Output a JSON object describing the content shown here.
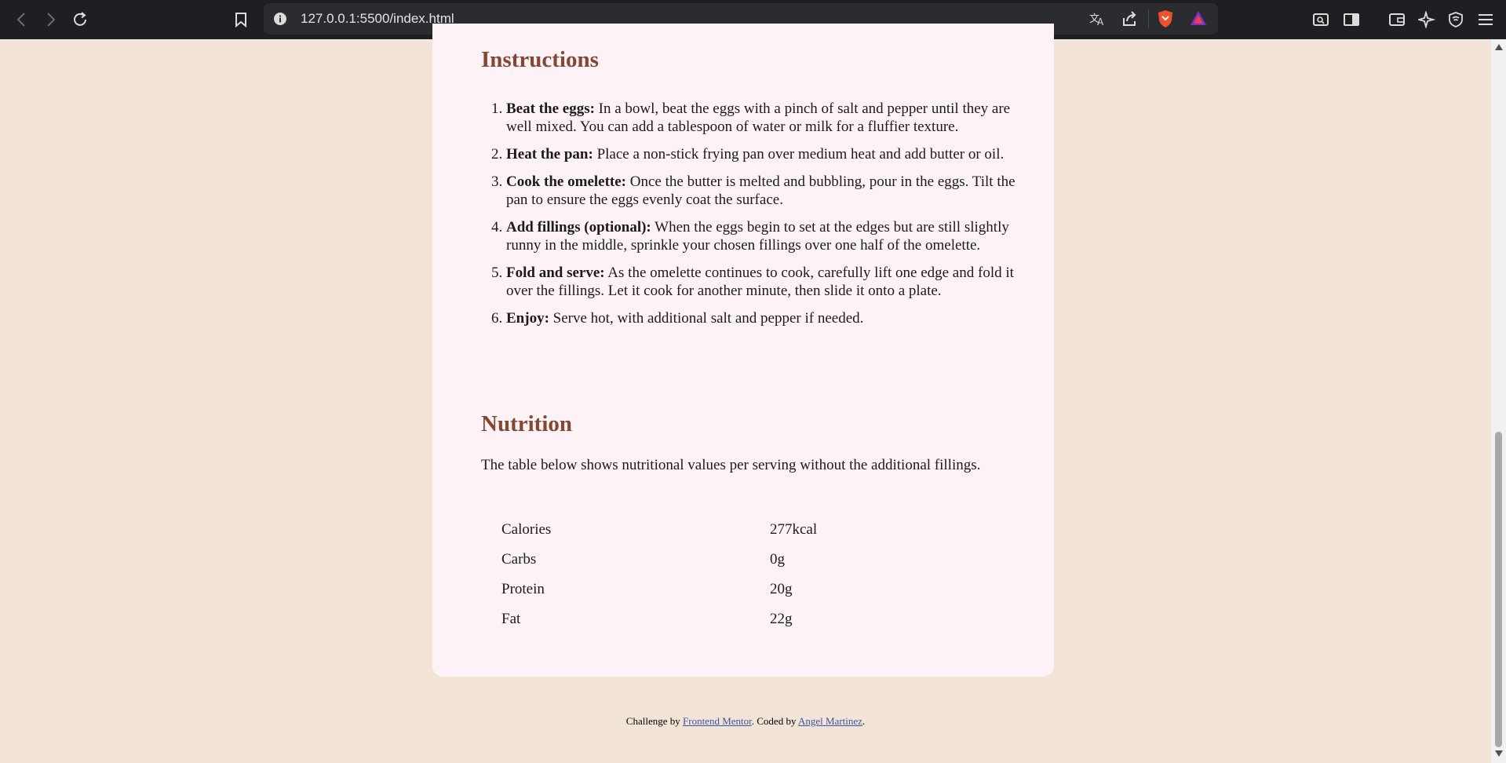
{
  "browser": {
    "url": "127.0.0.1:5500/index.html"
  },
  "instructions": {
    "heading": "Instructions",
    "steps": [
      {
        "number": "1.",
        "title": "Beat the eggs:",
        "text": " In a bowl, beat the eggs with a pinch of salt and pepper until they are well mixed. You can add a tablespoon of water or milk for a fluffier texture."
      },
      {
        "number": "2.",
        "title": "Heat the pan:",
        "text": " Place a non-stick frying pan over medium heat and add butter or oil."
      },
      {
        "number": "3.",
        "title": "Cook the omelette:",
        "text": " Once the butter is melted and bubbling, pour in the eggs. Tilt the pan to ensure the eggs evenly coat the surface."
      },
      {
        "number": "4.",
        "title": "Add fillings (optional):",
        "text": " When the eggs begin to set at the edges but are still slightly runny in the middle, sprinkle your chosen fillings over one half of the omelette."
      },
      {
        "number": "5.",
        "title": "Fold and serve:",
        "text": " As the omelette continues to cook, carefully lift one edge and fold it over the fillings. Let it cook for another minute, then slide it onto a plate."
      },
      {
        "number": "6.",
        "title": "Enjoy:",
        "text": " Serve hot, with additional salt and pepper if needed."
      }
    ]
  },
  "nutrition": {
    "heading": "Nutrition",
    "intro": "The table below shows nutritional values per serving without the additional fillings.",
    "rows": [
      {
        "label": "Calories",
        "value": "277kcal"
      },
      {
        "label": "Carbs",
        "value": "0g"
      },
      {
        "label": "Protein",
        "value": "20g"
      },
      {
        "label": "Fat",
        "value": "22g"
      }
    ]
  },
  "footer": {
    "prefix": "Challenge by ",
    "link1": "Frontend Mentor",
    "middle": ". Coded by ",
    "link2": "Angel Martinez",
    "suffix": "."
  },
  "colors": {
    "page_bg": "#f2e5d8",
    "card_bg": "#fdf3f7",
    "heading": "#854632",
    "link": "#3e52a3"
  }
}
